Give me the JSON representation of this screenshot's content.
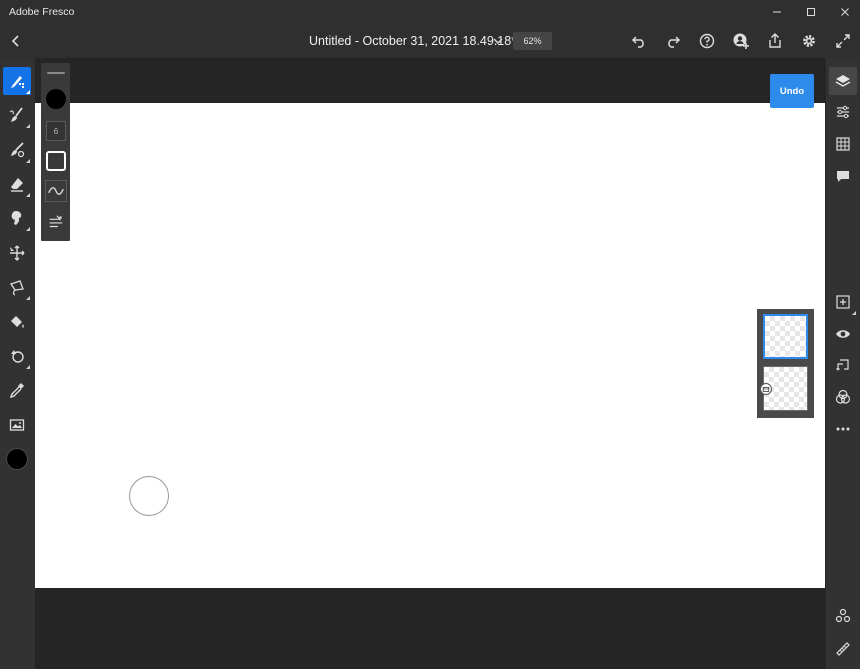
{
  "window": {
    "app_title": "Adobe Fresco",
    "controls": [
      "minimize-icon",
      "maximize-icon",
      "close-icon"
    ]
  },
  "appbar": {
    "back_icon": "chevron-left-icon",
    "document_title": "Untitled - October 31, 2021 18.49.18*",
    "zoom": "62%",
    "actions": [
      "undo-icon",
      "redo-icon",
      "help-icon",
      "invite-icon",
      "share-icon",
      "settings-icon",
      "fullscreen-icon"
    ]
  },
  "left_toolbar": {
    "tools": [
      "pixel-brush-icon",
      "live-brush-icon",
      "vector-brush-icon",
      "eraser-icon",
      "smudge-icon",
      "move-icon",
      "lasso-select-icon",
      "fill-icon",
      "shapes-icon",
      "eyedropper-icon",
      "image-icon",
      "color-swatch-icon"
    ],
    "active_tool": "pixel-brush-icon",
    "current_color": "#000000"
  },
  "brush_panel": {
    "size_value": "6",
    "items": [
      "brush-color-icon",
      "brush-size-field",
      "brush-shape-icon",
      "brush-smoothing-icon",
      "brush-settings-icon"
    ]
  },
  "canvas": {
    "background": "#ffffff"
  },
  "undo_button": {
    "label": "Undo",
    "color": "#2d8ceb"
  },
  "layers_panel": {
    "layers": [
      {
        "selected": true
      },
      {
        "selected": false
      }
    ]
  },
  "right_toolbar": {
    "items": [
      "layers-icon",
      "layer-properties-icon",
      "grid-icon",
      "comments-icon",
      "add-layer-icon",
      "visibility-icon",
      "import-icon",
      "blend-mode-icon",
      "more-options-icon",
      "bottom-layers-icon",
      "ruler-icon"
    ]
  },
  "colors": {
    "accent": "#1473e6",
    "toolbar_bg": "#323232",
    "workspace_bg": "#252525"
  }
}
